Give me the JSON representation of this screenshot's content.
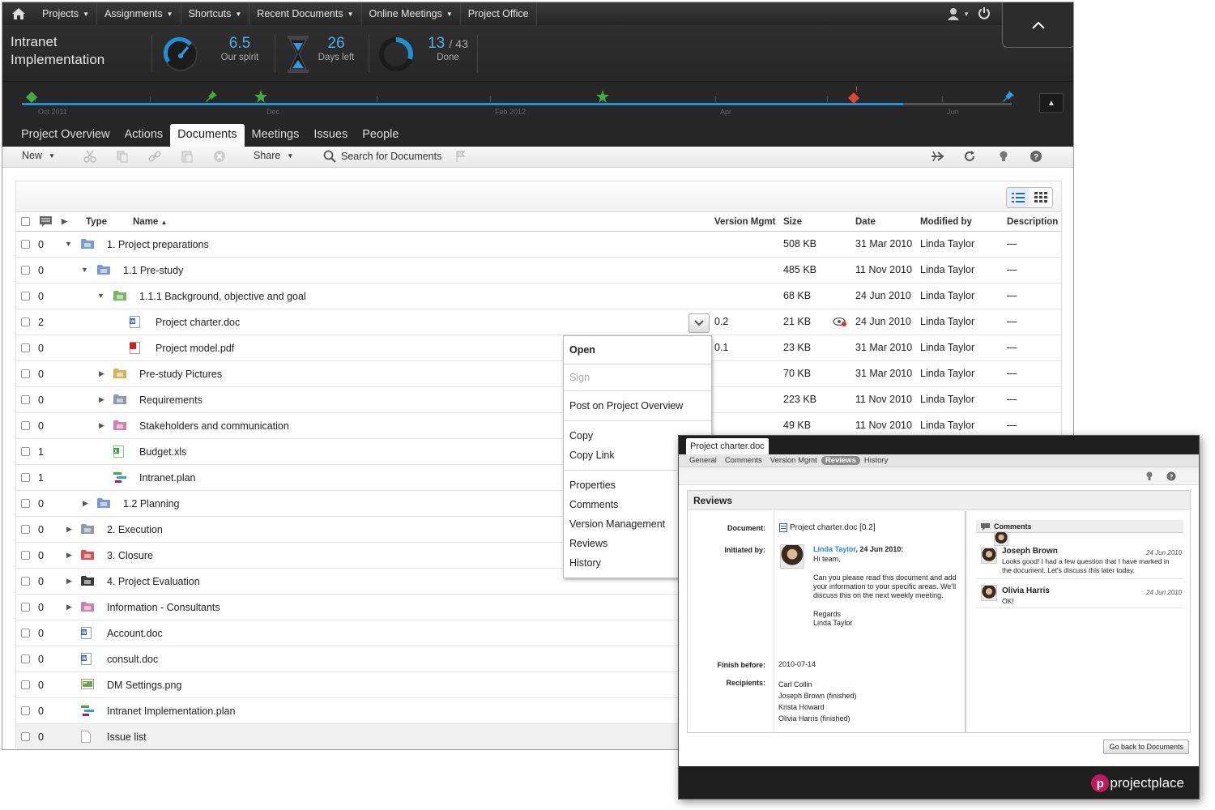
{
  "topnav": {
    "items": [
      {
        "label": "Projects",
        "dropdown": true
      },
      {
        "label": "Assignments",
        "dropdown": true
      },
      {
        "label": "Shortcuts",
        "dropdown": true
      },
      {
        "label": "Recent Documents",
        "dropdown": true
      },
      {
        "label": "Online Meetings",
        "dropdown": true
      },
      {
        "label": "Project Office",
        "dropdown": false
      }
    ]
  },
  "header": {
    "title_line1": "Intranet",
    "title_line2": "Implementation",
    "spirit_value": "6.5",
    "spirit_label": "Our spirit",
    "days_value": "26",
    "days_label": "Days left",
    "done_value": "13",
    "done_total": "/ 43",
    "done_label": "Done",
    "done_fraction": 0.302
  },
  "timeline": {
    "progress": 0.89,
    "months": [
      "Oct 2011",
      "Dec",
      "Feb 2012",
      "Apr",
      "Jun"
    ],
    "colors": {
      "track": "#1f8fd6",
      "milestone": "#3fae3a",
      "warning": "#e0442b",
      "pin": "#2f9be0"
    }
  },
  "tabs": [
    "Project Overview",
    "Actions",
    "Documents",
    "Meetings",
    "Issues",
    "People"
  ],
  "active_tab": "Documents",
  "toolbar": {
    "new_label": "New",
    "share_label": "Share",
    "search_label": "Search for Documents"
  },
  "table": {
    "headers": {
      "type": "Type",
      "name": "Name",
      "version": "Version Mgmt",
      "size": "Size",
      "date": "Date",
      "modified": "Modified by",
      "description": "Description"
    },
    "rows": [
      {
        "count": "0",
        "indent": 0,
        "expand": "open",
        "icon": "folder",
        "color": "#7a9ccc",
        "name": "1. Project preparations",
        "version": "",
        "size": "508 KB",
        "date": "31 Mar 2010",
        "modified": "Linda Taylor",
        "description": "—"
      },
      {
        "count": "0",
        "indent": 1,
        "expand": "open",
        "icon": "folder",
        "color": "#7a9ccc",
        "name": "1.1 Pre-study",
        "version": "",
        "size": "485 KB",
        "date": "11 Nov 2010",
        "modified": "Linda Taylor",
        "description": "—"
      },
      {
        "count": "0",
        "indent": 2,
        "expand": "open",
        "icon": "folder",
        "color": "#79b764",
        "name": "1.1.1 Background, objective and goal",
        "version": "",
        "size": "68 KB",
        "date": "24 Jun 2010",
        "modified": "Linda Taylor",
        "description": "—"
      },
      {
        "count": "2",
        "indent": 3,
        "expand": "none",
        "icon": "word",
        "color": "#2b5fb4",
        "name": "Project charter.doc",
        "version": "0.2",
        "size": "21 KB",
        "date": "24 Jun 2010",
        "modified": "Linda Taylor",
        "description": "—"
      },
      {
        "count": "0",
        "indent": 3,
        "expand": "none",
        "icon": "pdf",
        "color": "#cc2222",
        "name": "Project model.pdf",
        "version": "0.1",
        "size": "23 KB",
        "date": "31 Mar 2010",
        "modified": "Linda Taylor",
        "description": "—"
      },
      {
        "count": "0",
        "indent": 2,
        "expand": "closed",
        "icon": "folder",
        "color": "#d6b35a",
        "name": "Pre-study Pictures",
        "version": "",
        "size": "70 KB",
        "date": "31 Mar 2010",
        "modified": "Linda Taylor",
        "description": "—"
      },
      {
        "count": "0",
        "indent": 2,
        "expand": "closed",
        "icon": "folder",
        "color": "#8e9aa8",
        "name": "Requirements",
        "version": "",
        "size": "223 KB",
        "date": "11 Nov 2010",
        "modified": "Linda Taylor",
        "description": "—"
      },
      {
        "count": "0",
        "indent": 2,
        "expand": "closed",
        "icon": "folder",
        "color": "#d082a8",
        "name": "Stakeholders and communication",
        "version": "",
        "size": "49 KB",
        "date": "11 Nov 2010",
        "modified": "Linda Taylor",
        "description": "—"
      },
      {
        "count": "1",
        "indent": 2,
        "expand": "none",
        "icon": "excel",
        "color": "#3a9a3a",
        "name": "Budget.xls",
        "version": "",
        "size": "",
        "date": "",
        "modified": "",
        "description": ""
      },
      {
        "count": "1",
        "indent": 2,
        "expand": "none",
        "icon": "plan",
        "color": "#2aa7c9",
        "name": "Intranet.plan",
        "version": "",
        "size": "",
        "date": "",
        "modified": "",
        "description": ""
      },
      {
        "count": "0",
        "indent": 1,
        "expand": "closed",
        "icon": "folder",
        "color": "#7a9ccc",
        "name": "1.2 Planning",
        "version": "",
        "size": "",
        "date": "",
        "modified": "",
        "description": ""
      },
      {
        "count": "0",
        "indent": 0,
        "expand": "closed",
        "icon": "folder",
        "color": "#8e9aa8",
        "name": "2. Execution",
        "version": "",
        "size": "",
        "date": "",
        "modified": "",
        "description": ""
      },
      {
        "count": "0",
        "indent": 0,
        "expand": "closed",
        "icon": "folder",
        "color": "#d9534f",
        "name": "3. Closure",
        "version": "",
        "size": "",
        "date": "",
        "modified": "",
        "description": ""
      },
      {
        "count": "0",
        "indent": 0,
        "expand": "closed",
        "icon": "folder",
        "color": "#3a3a3a",
        "name": "4. Project Evaluation",
        "version": "",
        "size": "",
        "date": "",
        "modified": "",
        "description": ""
      },
      {
        "count": "0",
        "indent": 0,
        "expand": "closed",
        "icon": "folder",
        "color": "#d082a8",
        "name": "Information - Consultants",
        "version": "",
        "size": "",
        "date": "",
        "modified": "",
        "description": ""
      },
      {
        "count": "0",
        "indent": 0,
        "expand": "none",
        "icon": "word",
        "color": "#2b5fb4",
        "name": "Account.doc",
        "version": "",
        "size": "",
        "date": "",
        "modified": "",
        "description": ""
      },
      {
        "count": "0",
        "indent": 0,
        "expand": "none",
        "icon": "word",
        "color": "#2b5fb4",
        "name": "consult.doc",
        "version": "",
        "size": "",
        "date": "",
        "modified": "",
        "description": ""
      },
      {
        "count": "0",
        "indent": 0,
        "expand": "none",
        "icon": "image",
        "color": "#6aa84f",
        "name": "DM Settings.png",
        "version": "",
        "size": "",
        "date": "",
        "modified": "",
        "description": ""
      },
      {
        "count": "0",
        "indent": 0,
        "expand": "none",
        "icon": "plan",
        "color": "#2aa7c9",
        "name": "Intranet Implementation.plan",
        "version": "",
        "size": "",
        "date": "",
        "modified": "",
        "description": ""
      },
      {
        "count": "0",
        "indent": 0,
        "expand": "none",
        "icon": "blank",
        "color": "#999999",
        "name": "Issue list",
        "version": "",
        "size": "",
        "date": "",
        "modified": "",
        "description": ""
      }
    ]
  },
  "context_menu": {
    "open": "Open",
    "sign": "Sign",
    "post": "Post on Project Overview",
    "copy": "Copy",
    "copy_link": "Copy Link",
    "properties": "Properties",
    "comments": "Comments",
    "version": "Version Management",
    "reviews": "Reviews",
    "history": "History"
  },
  "properties_window": {
    "title": "Project charter.doc",
    "subtabs": [
      "General",
      "Comments",
      "Version Mgmt",
      "Reviews",
      "History"
    ],
    "active_subtab": "Reviews",
    "section_title": "Reviews",
    "document_label": "Document:",
    "document_value": "Project charter.doc [0.2]",
    "initiated_label": "Initiated by:",
    "initiator": "Linda Taylor",
    "initiated_date": ", 24 Jun 2010:",
    "message_greeting": "Hi team,",
    "message_body1": "Can you please read this document and add",
    "message_body2": "your information to your specific areas. We'll",
    "message_body3": "discuss this on the next weekly meeting.",
    "message_regards": "Regards",
    "message_signature": "Linda Taylor",
    "finish_label": "Finish before:",
    "finish_value": "2010-07-14",
    "recipients_label": "Recipients:",
    "recipients": [
      "Carl Collin",
      "Joseph Brown (finished)",
      "Krista Howard",
      "Olivia Harris (finished)"
    ],
    "comments_title": "Comments",
    "comments": [
      {
        "author": "Joseph Brown",
        "date": "24 Jun 2010",
        "text1": "Looks good! I had a few question that I have marked in",
        "text2": "the document. Let's discuss this later today."
      },
      {
        "author": "Olivia Harris",
        "date": "24 Jun 2010",
        "text1": "OK!",
        "text2": ""
      }
    ],
    "back_button": "Go back to Documents",
    "logo_text": "projectplace"
  }
}
